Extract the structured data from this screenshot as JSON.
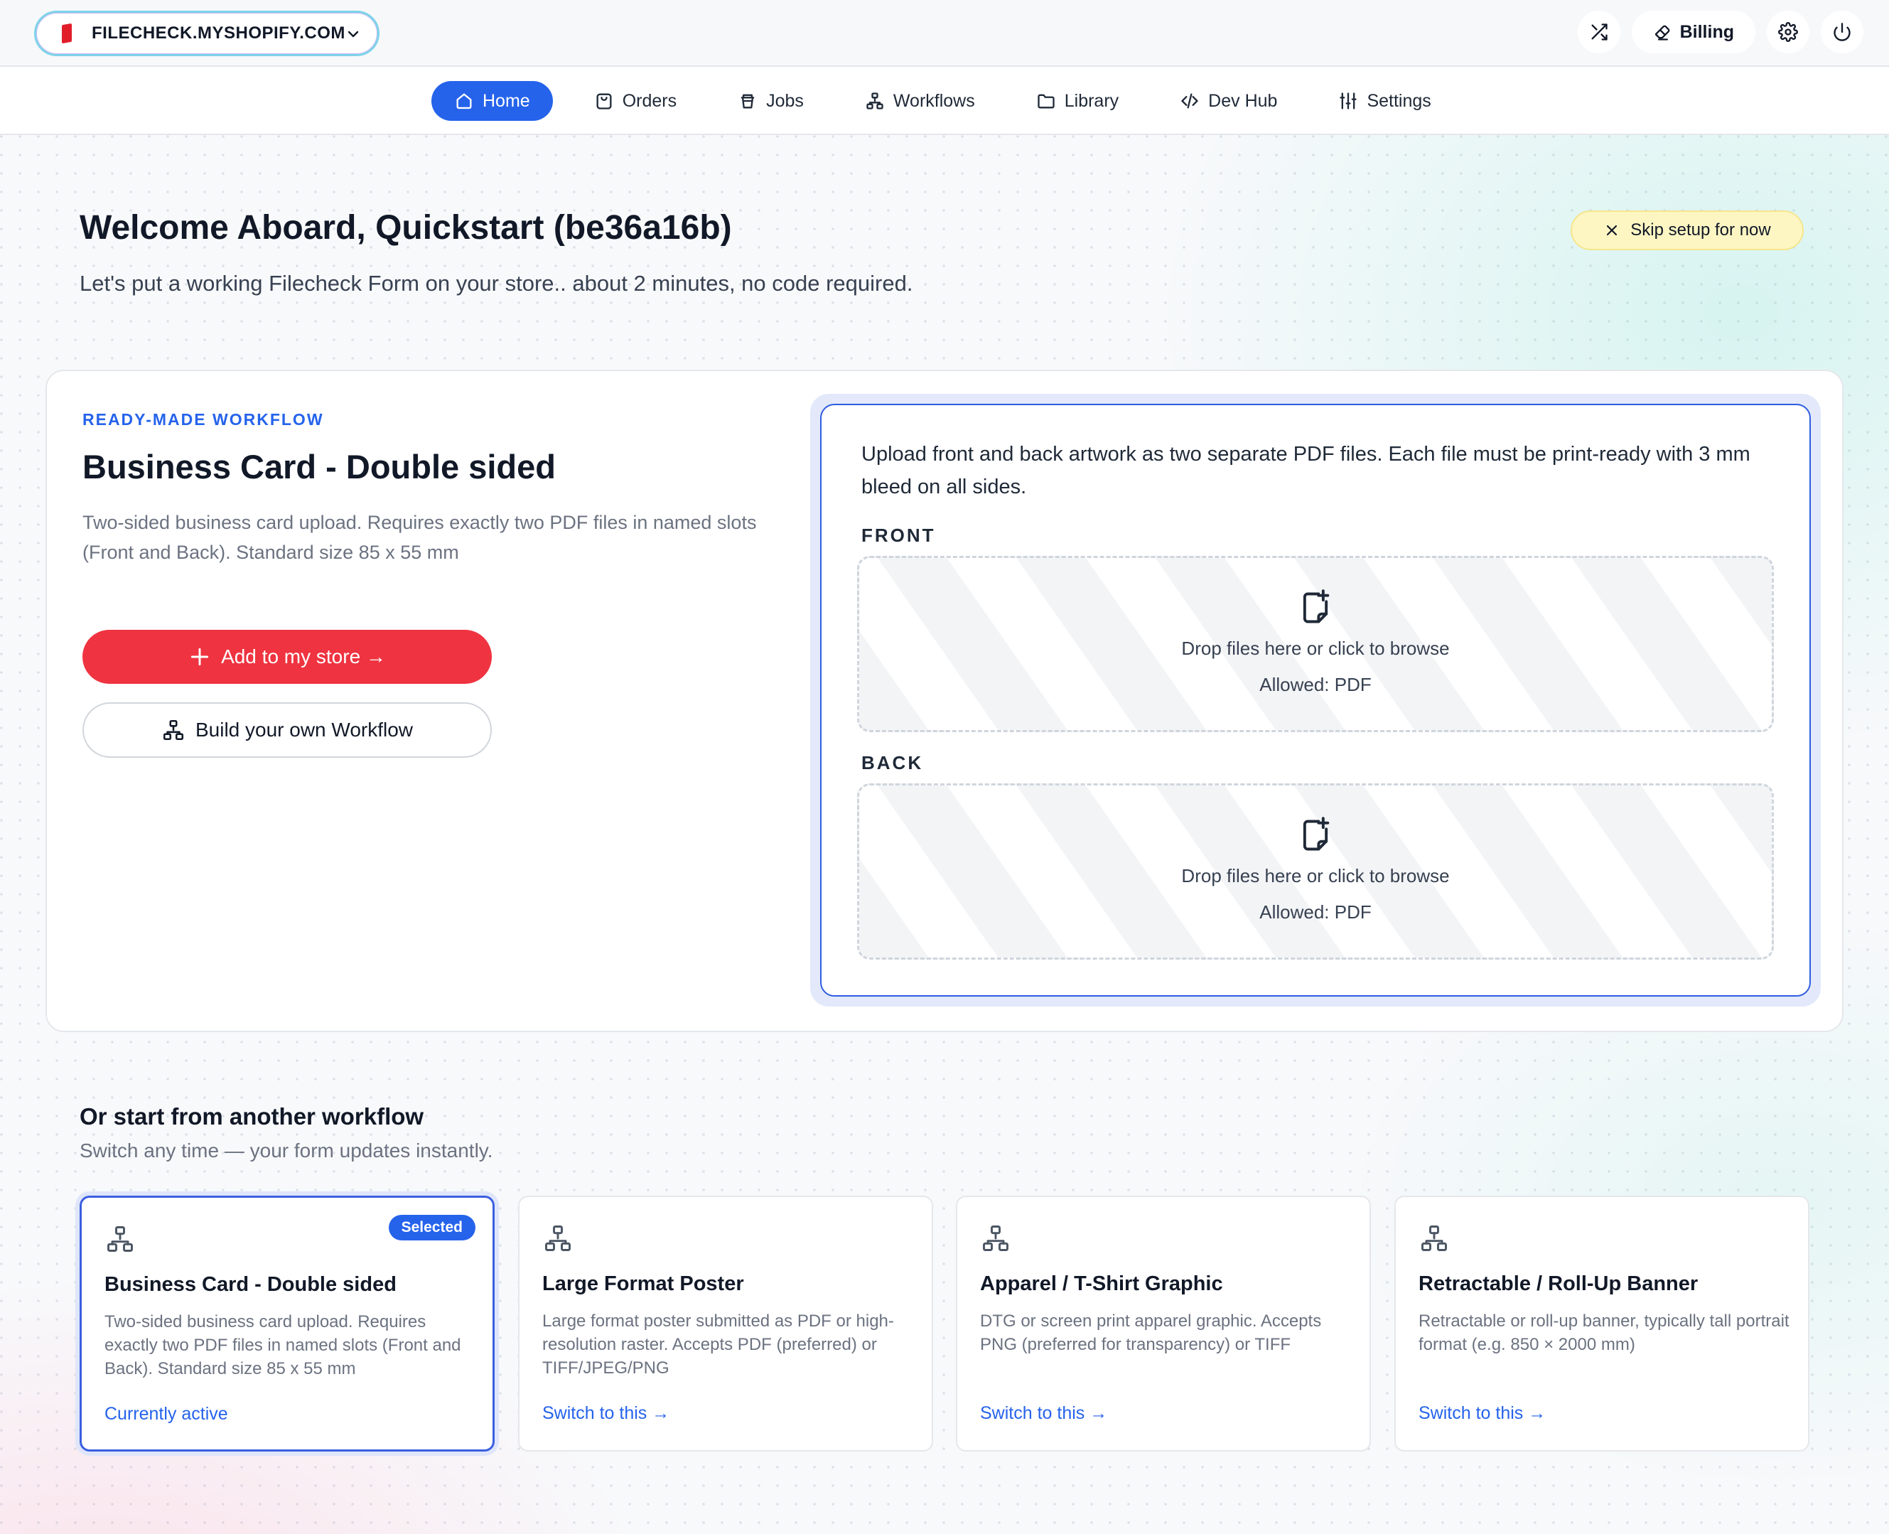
{
  "topbar": {
    "store_name": "FILECHECK.MYSHOPIFY.COM",
    "billing_label": "Billing"
  },
  "nav": {
    "items": [
      {
        "label": "Home",
        "icon": "home-icon",
        "active": true
      },
      {
        "label": "Orders",
        "icon": "shopping-bag-icon"
      },
      {
        "label": "Jobs",
        "icon": "cup-icon"
      },
      {
        "label": "Workflows",
        "icon": "workflow-icon"
      },
      {
        "label": "Library",
        "icon": "folder-icon"
      },
      {
        "label": "Dev Hub",
        "icon": "code-icon"
      },
      {
        "label": "Settings",
        "icon": "sliders-icon"
      }
    ]
  },
  "header": {
    "title": "Welcome Aboard, Quickstart (be36a16b)",
    "subtitle": "Let's put a working Filecheck Form on your store.. about 2 minutes, no code required.",
    "skip_label": "Skip setup for now"
  },
  "main": {
    "eyebrow": "READY-MADE WORKFLOW",
    "title": "Business Card - Double sided",
    "description": "Two-sided business card upload. Requires exactly two PDF files in named slots (Front and Back). Standard size 85 x 55 mm",
    "add_label": "Add to my store →",
    "build_label": "Build your own Workflow",
    "preview": {
      "description": "Upload front and back artwork as two separate PDF files. Each file must be print-ready with 3 mm bleed on all sides.",
      "slots": [
        {
          "label": "FRONT",
          "drop_text": "Drop files here or click to browse",
          "allowed": "Allowed: PDF"
        },
        {
          "label": "BACK",
          "drop_text": "Drop files here or click to browse",
          "allowed": "Allowed: PDF"
        }
      ]
    }
  },
  "others": {
    "title": "Or start from another workflow",
    "subtitle": "Switch any time — your form updates instantly.",
    "cards": [
      {
        "title": "Business Card - Double sided",
        "description": "Two-sided business card upload. Requires exactly two PDF files in named slots (Front and Back). Standard size 85 x 55 mm",
        "link": "Currently active",
        "badge": "Selected"
      },
      {
        "title": "Large Format Poster",
        "description": "Large format poster submitted as PDF or high-resolution raster. Accepts PDF (preferred) or TIFF/JPEG/PNG",
        "link": "Switch to this →"
      },
      {
        "title": "Apparel / T-Shirt Graphic",
        "description": "DTG or screen print apparel graphic. Accepts PNG (preferred for transparency) or TIFF",
        "link": "Switch to this →"
      },
      {
        "title": "Retractable / Roll-Up Banner",
        "description": "Retractable or roll-up banner, typically tall portrait format (e.g. 850 × 2000 mm)",
        "link": "Switch to this →"
      }
    ]
  },
  "colors": {
    "accent": "#2563eb",
    "danger": "#ef3340",
    "skip_bg": "#fdf6c3"
  }
}
